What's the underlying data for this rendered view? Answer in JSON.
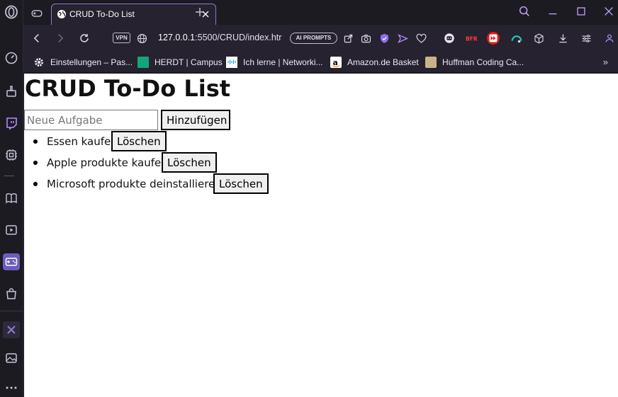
{
  "browser": {
    "tab": {
      "title": "CRUD To-Do List"
    },
    "address_bar": {
      "url_host": "127.0.0.1",
      "url_path": ":5500/CRUD/index.htr"
    },
    "vpn_label": "VPN",
    "ai_prompts_label": "AI PROMPTS",
    "bookmarks": [
      {
        "label": "Einstellungen – Pas...",
        "icon": "gear-icon"
      },
      {
        "label": "HERDT | Campus",
        "icon": "herdt-favicon"
      },
      {
        "label": "Ich lerne | Networki...",
        "icon": "cisco-favicon"
      },
      {
        "label": "Amazon.de Basket",
        "icon": "amazon-favicon"
      },
      {
        "label": "Huffman Coding Ca...",
        "icon": "huffman-favicon"
      }
    ],
    "bookmarks_more": "»",
    "accent_color": "#8a7ad0"
  },
  "page": {
    "title": "CRUD To-Do List",
    "input_placeholder": "Neue Aufgabe",
    "input_value": "",
    "add_button_label": "Hinzufügen",
    "todos": [
      {
        "text": "Essen kaufen",
        "delete_label": "Löschen"
      },
      {
        "text": "Apple produkte kaufen",
        "delete_label": "Löschen"
      },
      {
        "text": "Microsoft produkte deinstallieren",
        "delete_label": "Löschen"
      }
    ]
  }
}
